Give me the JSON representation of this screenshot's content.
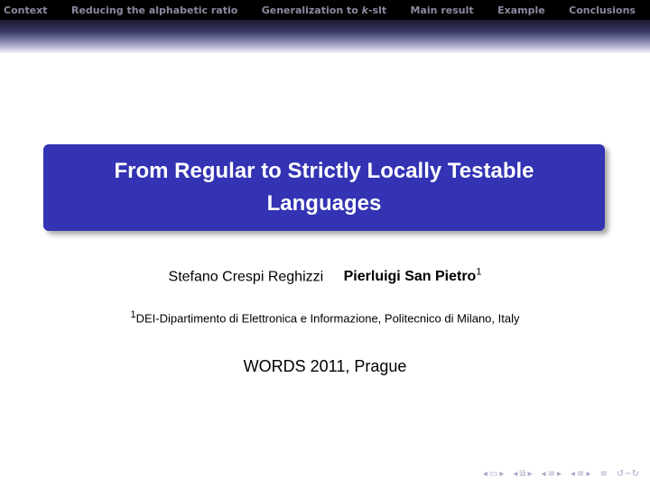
{
  "nav": {
    "items": [
      {
        "label": "Context"
      },
      {
        "label": "Reducing the alphabetic ratio"
      },
      {
        "label_pre": "Generalization to ",
        "label_k": "k",
        "label_post": "-slt"
      },
      {
        "label": "Main result"
      },
      {
        "label": "Example"
      },
      {
        "label": "Conclusions"
      }
    ]
  },
  "title": {
    "line1": "From Regular to Strictly Locally Testable",
    "line2": "Languages"
  },
  "authors": {
    "author1": "Stefano Crespi Reghizzi",
    "author2": "Pierluigi San Pietro",
    "author2_mark": "1"
  },
  "affiliation": {
    "mark": "1",
    "text": "DEI-Dipartimento di Elettronica e Informazione, Politecnico di Milano, Italy"
  },
  "event": "WORDS 2011, Prague",
  "beamer_nav": {
    "icons": [
      "frame-prev-icon",
      "frame-icon",
      "frame-next-icon",
      "subsection-prev-icon",
      "subsection-icon",
      "subsection-next-icon",
      "section-prev-icon",
      "section-icon",
      "section-next-icon",
      "align-icon",
      "search-icon"
    ],
    "color": "#a8a8c8"
  },
  "colors": {
    "title_box": "#3333b3",
    "navbar": "#000000",
    "nav_text": "#8a8aa0"
  }
}
